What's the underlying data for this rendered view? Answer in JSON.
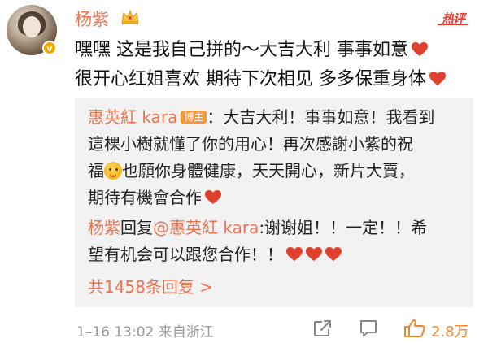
{
  "post": {
    "username": "杨紫",
    "hot_tag": "热评",
    "verified_badge": "v",
    "lines": [
      "嘿嘿 这是我自己拼的～大吉大利 事事如意",
      "很开心红姐喜欢 期待下次相见 多多保重身体"
    ]
  },
  "quote": {
    "author": "惠英紅 kara",
    "author_badge": "博主",
    "line1_rest": "：大吉大利！事事如意！我看到",
    "line2": "這棵小樹就懂了你的用心！再次感謝小紫的祝",
    "line3_pre": "福",
    "line3_post": "也願你身體健康，天天開心，新片大賣，",
    "line4": "期待有機會合作"
  },
  "reply": {
    "replier": "杨紫",
    "reply_word": "回复",
    "mention": "@惠英紅 kara",
    "line1_rest": ":谢谢姐！！一定！！希",
    "line2": "望有机会可以跟您合作！！"
  },
  "reply_count_label": "共1458条回复 >",
  "footer": {
    "time": "1–16 13:02 来自浙江",
    "like_count": "2.8万"
  },
  "icons": [
    "crown-icon",
    "heart-icon",
    "grin-emoji-icon",
    "share-icon",
    "comment-icon",
    "thumbs-up-icon"
  ],
  "colors": {
    "accent": "#eb7350",
    "heart": "#e0412f",
    "like": "#f0882e",
    "quote_bg": "#f2f2f2"
  }
}
